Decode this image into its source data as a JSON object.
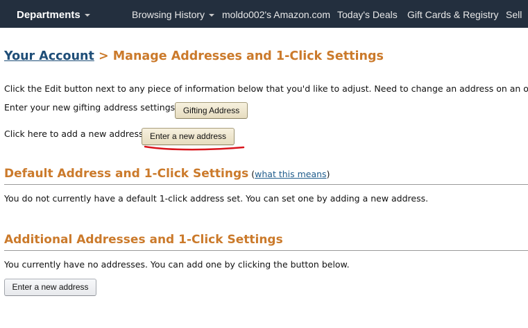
{
  "nav": {
    "departments_label": "Departments",
    "links": [
      "Browsing History",
      "moldo002's Amazon.com",
      "Today's Deals",
      "Gift Cards & Registry",
      "Sell"
    ]
  },
  "page": {
    "breadcrumb_link": "Your Account",
    "breadcrumb_sep": " > ",
    "breadcrumb_current": "Manage Addresses and 1-Click Settings",
    "intro_text": "Click the Edit button next to any piece of information below that you'd like to adjust. Need to change an address on an open",
    "gifting_text": "Enter your new gifting address settings,",
    "gifting_button": "Gifting Address",
    "add_address_text": "Click here to add a new address",
    "add_address_button": "Enter a new address"
  },
  "default_section": {
    "title": "Default Address and 1-Click Settings",
    "paren_open": " (",
    "link": "what this means",
    "paren_close": ")",
    "text": "You do not currently have a default 1-click address set. You can set one by adding a new address."
  },
  "additional_section": {
    "title": "Additional Addresses and 1-Click Settings",
    "text": "You currently have no addresses. You can add one by clicking the button below.",
    "button": "Enter a new address"
  },
  "colors": {
    "nav_bg": "#232f3e",
    "heading_orange": "#cb7a2b",
    "link_blue": "#1f4e78",
    "annotation_red": "#d9141c"
  }
}
